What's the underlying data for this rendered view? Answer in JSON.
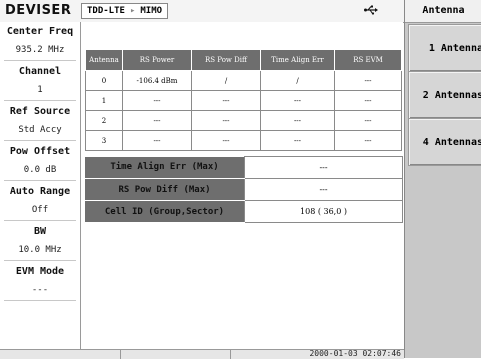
{
  "header": {
    "logo_text": "DEVISER",
    "mode_primary": "TDD-LTE",
    "mode_separator": "▸",
    "mode_secondary": "MIMO",
    "usb_icon": "usb-icon"
  },
  "params": [
    {
      "label": "Center Freq",
      "value": "935.2 MHz"
    },
    {
      "label": "Channel",
      "value": "1"
    },
    {
      "label": "Ref Source",
      "value": "Std Accy"
    },
    {
      "label": "Pow Offset",
      "value": "0.0 dB"
    },
    {
      "label": "Auto Range",
      "value": "Off"
    },
    {
      "label": "BW",
      "value": "10.0 MHz"
    },
    {
      "label": "EVM Mode",
      "value": "---"
    }
  ],
  "antenna_table": {
    "headers": [
      "Antenna",
      "RS Power",
      "RS Pow Diff",
      "Time Align Err",
      "RS EVM"
    ],
    "rows": [
      [
        "0",
        "-106.4 dBm",
        "/",
        "/",
        "---"
      ],
      [
        "1",
        "---",
        "---",
        "---",
        "---"
      ],
      [
        "2",
        "---",
        "---",
        "---",
        "---"
      ],
      [
        "3",
        "---",
        "---",
        "---",
        "---"
      ]
    ]
  },
  "summary_table": {
    "rows": [
      {
        "label": "Time Align Err (Max)",
        "value": "---"
      },
      {
        "label": "RS Pow Diff (Max)",
        "value": "---"
      },
      {
        "label": "Cell ID (Group,Sector)",
        "value": "108 ( 36,0 )"
      }
    ]
  },
  "softkeys": {
    "title": "Antenna",
    "items": [
      "1 Antenna",
      "2 Antennas",
      "4 Antennas"
    ]
  },
  "status": {
    "datetime": "2000-01-03 02:07:46"
  }
}
